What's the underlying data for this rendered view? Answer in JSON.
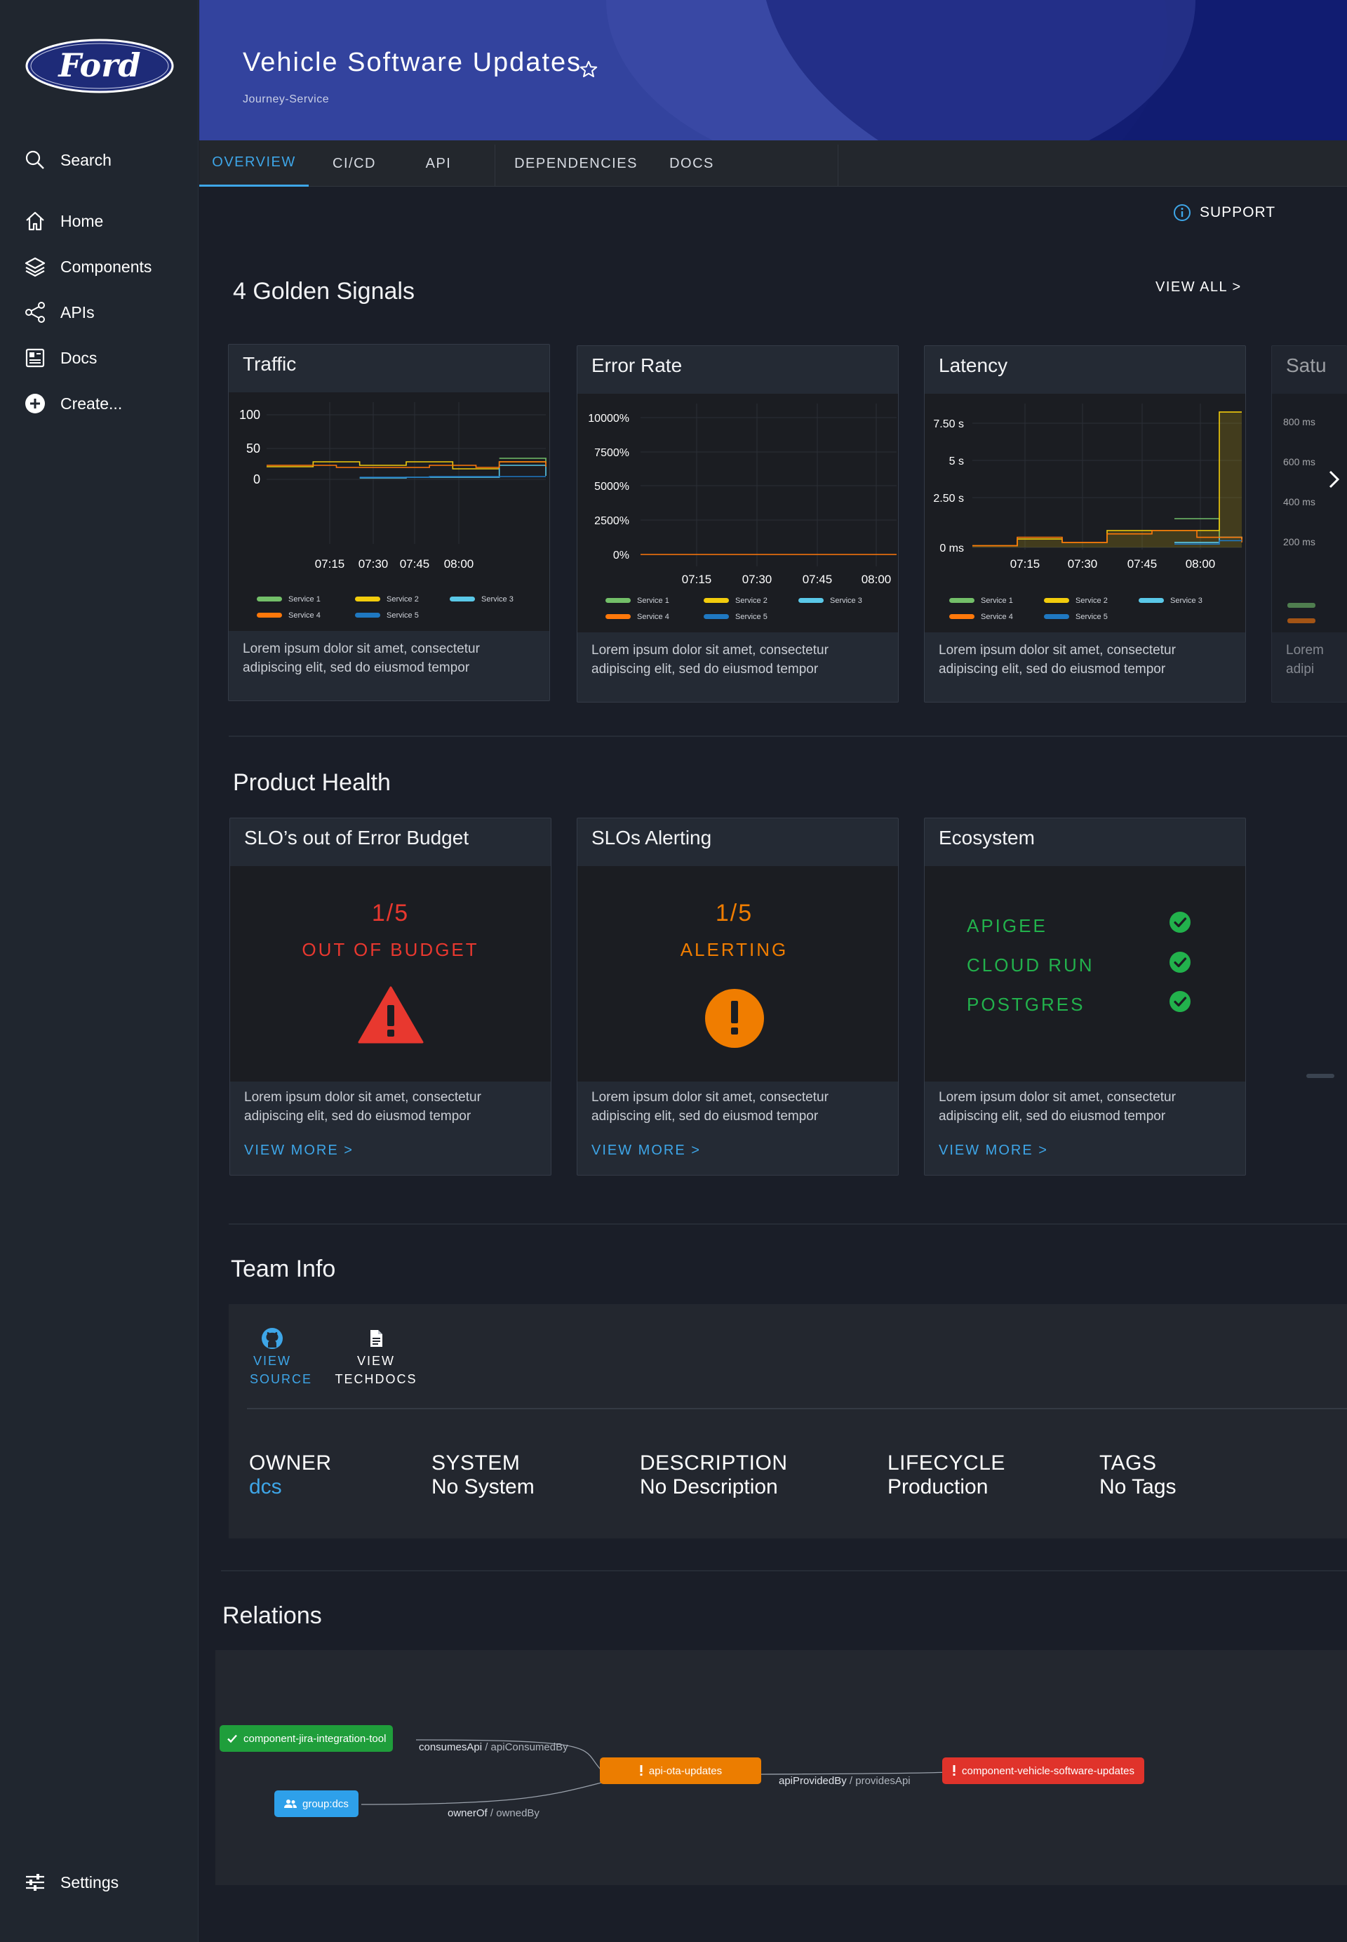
{
  "sidebar": {
    "items": [
      {
        "label": "Search",
        "icon": "search-icon"
      },
      {
        "label": "Home",
        "icon": "home-icon"
      },
      {
        "label": "Components",
        "icon": "layers-icon"
      },
      {
        "label": "APIs",
        "icon": "share-icon"
      },
      {
        "label": "Docs",
        "icon": "docs-icon"
      },
      {
        "label": "Create...",
        "icon": "add-circle-icon"
      }
    ],
    "settings_label": "Settings",
    "logo_text": "Ford"
  },
  "header": {
    "title": "Vehicle Software Updates",
    "subtitle": "Journey-Service"
  },
  "tabs": [
    {
      "label": "OVERVIEW",
      "active": true
    },
    {
      "label": "CI/CD"
    },
    {
      "label": "API"
    },
    {
      "label": "DEPENDENCIES"
    },
    {
      "label": "DOCS"
    }
  ],
  "support_label": "SUPPORT",
  "golden_signals": {
    "title": "4 Golden Signals",
    "view_all": "VIEW ALL >",
    "description": "Lorem ipsum dolor sit amet, consectetur adipiscing elit, sed do eiusmod tempor",
    "legend": [
      "Service 1",
      "Service 2",
      "Service 3",
      "Service 4",
      "Service 5"
    ],
    "legend_colors": [
      "#73bf69",
      "#f2cc0c",
      "#5ac8e8",
      "#ff780a",
      "#1f78c1"
    ],
    "cards": [
      {
        "title": "Traffic",
        "yticks": [
          "100",
          "50",
          "0"
        ]
      },
      {
        "title": "Error Rate",
        "yticks": [
          "10000%",
          "7500%",
          "5000%",
          "2500%",
          "0%"
        ]
      },
      {
        "title": "Latency",
        "yticks": [
          "7.50 s",
          "5 s",
          "2.50 s",
          "0 ms"
        ]
      },
      {
        "title": "Saturation",
        "title_visible": "Satu",
        "yticks": [
          "800 ms",
          "600 ms",
          "400 ms",
          "200 ms"
        ],
        "desc_visible": [
          "Lorem",
          "adipi"
        ]
      }
    ],
    "xticks": [
      "07:15",
      "07:30",
      "07:45",
      "08:00"
    ]
  },
  "chart_data": [
    {
      "type": "line",
      "title": "Traffic",
      "x": [
        "07:05",
        "07:10",
        "07:15",
        "07:20",
        "07:25",
        "07:30",
        "07:35",
        "07:40",
        "07:45",
        "07:50",
        "07:55",
        "08:00",
        "08:03"
      ],
      "ylim": [
        0,
        110
      ],
      "series": [
        {
          "name": "Service 1",
          "values": [
            null,
            null,
            null,
            null,
            null,
            null,
            null,
            null,
            null,
            null,
            30,
            30,
            22
          ]
        },
        {
          "name": "Service 2",
          "values": [
            18,
            18,
            25,
            25,
            20,
            20,
            25,
            25,
            15,
            15,
            25,
            25,
            25
          ]
        },
        {
          "name": "Service 3",
          "values": [
            null,
            null,
            null,
            null,
            2,
            2,
            3,
            3,
            3,
            3,
            20,
            20,
            5
          ]
        },
        {
          "name": "Service 4",
          "values": [
            20,
            20,
            20,
            17,
            17,
            17,
            17,
            20,
            20,
            17,
            25,
            25,
            18
          ]
        },
        {
          "name": "Service 5",
          "values": [
            null,
            null,
            null,
            null,
            3,
            3,
            3,
            4,
            4,
            4,
            4,
            4,
            4
          ]
        }
      ]
    },
    {
      "type": "line",
      "title": "Error Rate",
      "x": [
        "07:05",
        "08:05"
      ],
      "ylim": [
        0,
        10000
      ],
      "series": [
        {
          "name": "Service 4",
          "values": [
            0,
            0
          ]
        }
      ]
    },
    {
      "type": "area",
      "title": "Latency",
      "x": [
        "07:05",
        "07:10",
        "07:15",
        "07:20",
        "07:25",
        "07:30",
        "07:35",
        "07:40",
        "07:45",
        "07:50",
        "07:55",
        "08:00",
        "08:03"
      ],
      "ylim": [
        0,
        8.5
      ],
      "series": [
        {
          "name": "Service 1",
          "values": [
            null,
            null,
            null,
            null,
            null,
            null,
            null,
            null,
            null,
            1.7,
            1.7,
            0.6,
            0.5
          ]
        },
        {
          "name": "Service 2",
          "values": [
            0.1,
            0.1,
            0.5,
            0.5,
            0.3,
            0.3,
            1.0,
            1.0,
            1.0,
            1.0,
            1.0,
            8.0,
            8.0
          ]
        },
        {
          "name": "Service 3",
          "values": [
            null,
            null,
            null,
            null,
            null,
            null,
            null,
            null,
            null,
            0.3,
            0.3,
            0.6,
            0.5
          ]
        },
        {
          "name": "Service 4",
          "values": [
            0.1,
            0.1,
            0.6,
            0.6,
            0.3,
            0.3,
            0.8,
            0.8,
            1.0,
            1.0,
            0.6,
            0.6,
            0.3
          ]
        },
        {
          "name": "Service 5",
          "values": [
            null,
            null,
            null,
            null,
            null,
            null,
            null,
            null,
            null,
            0.2,
            0.2,
            0.4,
            0.4
          ]
        }
      ]
    }
  ],
  "product_health": {
    "title": "Product Health",
    "description": "Lorem ipsum dolor sit amet, consectetur adipiscing elit, sed do eiusmod tempor",
    "view_more": "VIEW MORE >",
    "slo_budget": {
      "title": "SLO’s out of Error Budget",
      "value": "1/5",
      "label": "OUT OF BUDGET",
      "color": "#e8382f"
    },
    "slo_alerting": {
      "title": "SLOs Alerting",
      "value": "1/5",
      "label": "ALERTING",
      "color": "#f07d00"
    },
    "ecosystem": {
      "title": "Ecosystem",
      "items": [
        "APIGEE",
        "CLOUD RUN",
        "POSTGRES"
      ],
      "color": "#22b14c"
    }
  },
  "team_info": {
    "title": "Team Info",
    "view_source_1": "VIEW",
    "view_source_2": "SOURCE",
    "view_techdocs_1": "VIEW",
    "view_techdocs_2": "TECHDOCS",
    "fields": [
      {
        "label": "OWNER",
        "value": "dcs",
        "link": true
      },
      {
        "label": "SYSTEM",
        "value": "No System"
      },
      {
        "label": "DESCRIPTION",
        "value": "No Description"
      },
      {
        "label": "LIFECYCLE",
        "value": "Production"
      },
      {
        "label": "TAGS",
        "value": "No Tags"
      }
    ]
  },
  "relations": {
    "title": "Relations",
    "nodes": {
      "jira": "component-jira-integration-tool",
      "group": "group:dcs",
      "api": "api-ota-updates",
      "component": "component-vehicle-software-updates"
    },
    "edges": {
      "consumes_a": "consumesApi",
      "consumes_b": " / apiConsumedBy",
      "owner_a": "ownerOf",
      "owner_b": " / ownedBy",
      "provided_a": "apiProvidedBy",
      "provided_b": " / providesApi"
    },
    "colors": {
      "green": "#1f9e3b",
      "blue": "#2ea0ea",
      "orange": "#ec7d00",
      "red": "#e0332b"
    }
  }
}
